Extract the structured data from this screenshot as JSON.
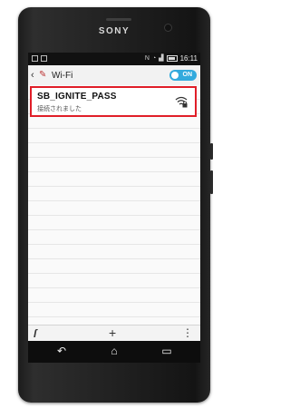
{
  "device": {
    "brand": "SONY"
  },
  "status_bar": {
    "time": "16:11",
    "icons": [
      "image-icon",
      "notification-icon",
      "nfc-icon",
      "wifi-icon",
      "signal-icon",
      "battery-icon"
    ]
  },
  "header": {
    "title": "Wi-Fi",
    "toggle_label": "ON"
  },
  "networks": [
    {
      "ssid": "SB_IGNITE_PASS",
      "status": "接続されました",
      "icon": "wifi-locked-icon"
    }
  ],
  "bottom_bar": {
    "add_label": "+",
    "menu_label": "⋮",
    "left_icon": "wps-icon"
  },
  "nav_bar": {
    "icons": [
      "back-icon",
      "home-icon",
      "recent-apps-icon"
    ]
  },
  "colors": {
    "accent": "#33aadd",
    "highlight": "#e01e28"
  }
}
